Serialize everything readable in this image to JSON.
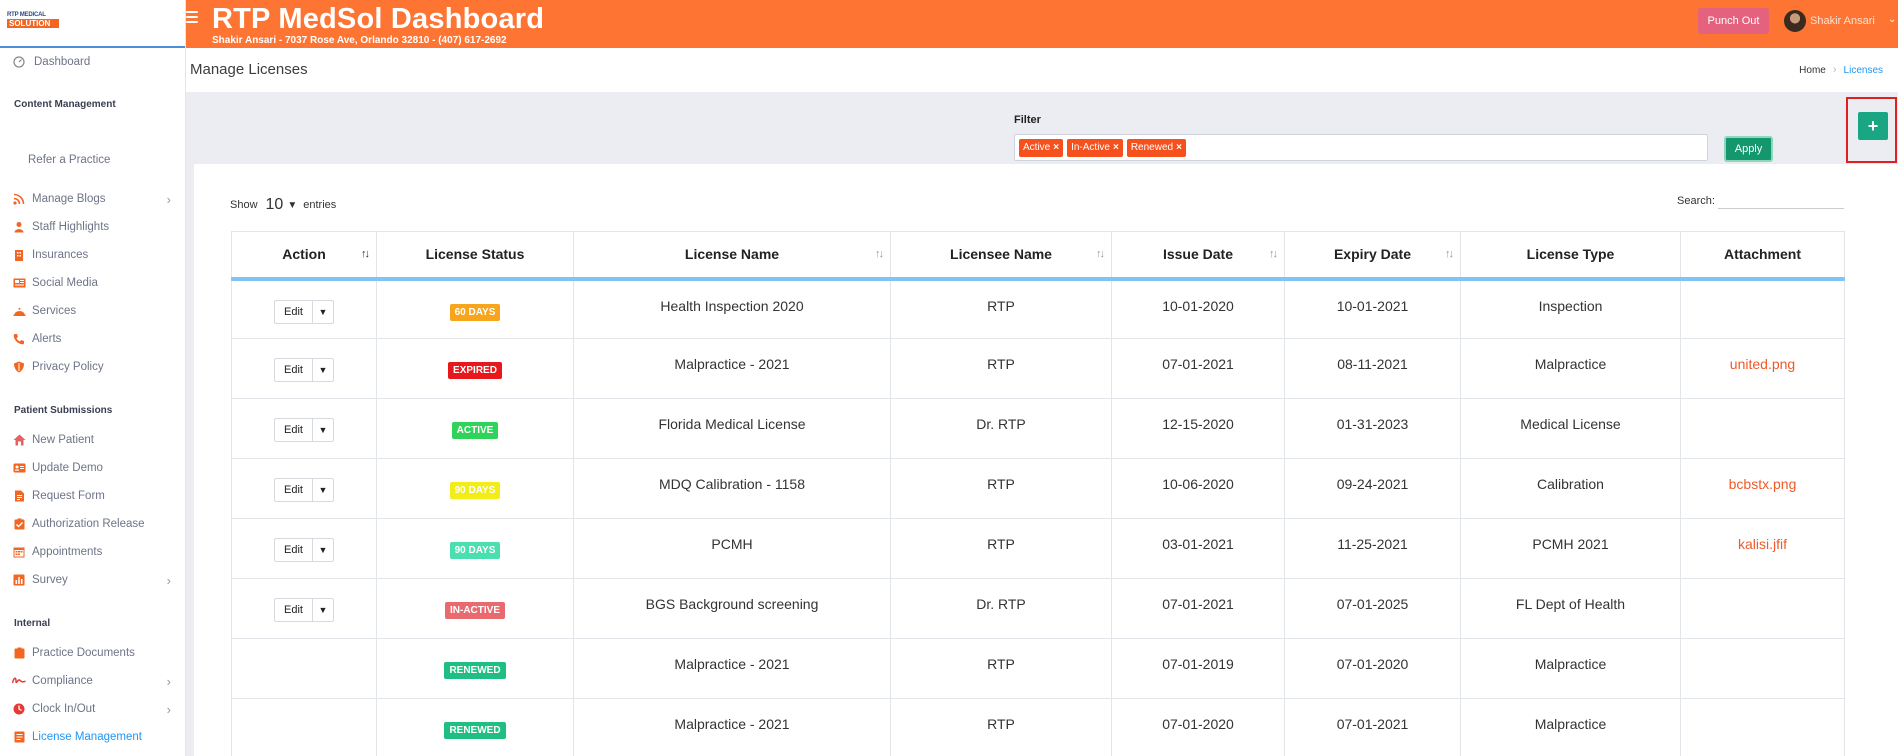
{
  "sidebar": {
    "logo_line1": "RTP MEDICAL",
    "logo_line2": "SOLUTION",
    "dashboard": "Dashboard",
    "sections": {
      "content": "Content Management",
      "patient": "Patient Submissions",
      "internal": "Internal"
    },
    "refer": "Refer a Practice",
    "items": {
      "blogs": "Manage Blogs",
      "staff": "Staff Highlights",
      "insurances": "Insurances",
      "social": "Social Media",
      "services": "Services",
      "alerts": "Alerts",
      "privacy": "Privacy Policy",
      "new_patient": "New Patient",
      "update_demo": "Update Demo",
      "request_form": "Request Form",
      "auth_release": "Authorization Release",
      "appointments": "Appointments",
      "survey": "Survey",
      "practice_docs": "Practice Documents",
      "compliance": "Compliance",
      "clock": "Clock In/Out",
      "license_mgmt": "License Management"
    },
    "accent": "#f26522",
    "active_color": "#2196f3"
  },
  "topbar": {
    "title": "RTP MedSol Dashboard",
    "subtitle": "Shakir Ansari - 7037 Rose Ave, Orlando 32810 - (407) 617-2692",
    "punch_out": "Punch Out",
    "user_name": "Shakir Ansari",
    "color": "#fd7433"
  },
  "header": {
    "page_title": "Manage Licenses",
    "breadcrumb_home": "Home",
    "breadcrumb_current": "Licenses"
  },
  "filter": {
    "label": "Filter",
    "tags": [
      "Active",
      "In-Active",
      "Renewed"
    ],
    "apply": "Apply",
    "add": "+"
  },
  "table_controls": {
    "show": "Show",
    "entries_value": "10",
    "entries": "entries",
    "search": "Search:"
  },
  "table": {
    "columns": [
      "Action",
      "License Status",
      "License Name",
      "Licensee Name",
      "Issue Date",
      "Expiry Date",
      "License Type",
      "Attachment"
    ],
    "edit_label": "Edit",
    "rows": [
      {
        "has_action": true,
        "status": "60 DAYS",
        "status_kind": "b-60",
        "name": "Health Inspection 2020",
        "licensee": "RTP",
        "issue": "10-01-2020",
        "expiry": "10-01-2021",
        "type": "Inspection",
        "attachment": ""
      },
      {
        "has_action": true,
        "status": "EXPIRED",
        "status_kind": "b-exp",
        "name": "Malpractice - 2021",
        "licensee": "RTP",
        "issue": "07-01-2021",
        "expiry": "08-11-2021",
        "type": "Malpractice",
        "attachment": "united.png"
      },
      {
        "has_action": true,
        "status": "ACTIVE",
        "status_kind": "b-act",
        "name": "Florida Medical License",
        "licensee": "Dr. RTP",
        "issue": "12-15-2020",
        "expiry": "01-31-2023",
        "type": "Medical License",
        "attachment": ""
      },
      {
        "has_action": true,
        "status": "90 DAYS",
        "status_kind": "b-90y",
        "name": "MDQ Calibration - 1158",
        "licensee": "RTP",
        "issue": "10-06-2020",
        "expiry": "09-24-2021",
        "type": "Calibration",
        "attachment": "bcbstx.png"
      },
      {
        "has_action": true,
        "status": "90 DAYS",
        "status_kind": "b-90t",
        "name": "PCMH",
        "licensee": "RTP",
        "issue": "03-01-2021",
        "expiry": "11-25-2021",
        "type": "PCMH 2021",
        "attachment": "kalisi.jfif"
      },
      {
        "has_action": true,
        "status": "IN-ACTIVE",
        "status_kind": "b-in",
        "name": "BGS Background screening",
        "licensee": "Dr. RTP",
        "issue": "07-01-2021",
        "expiry": "07-01-2025",
        "type": "FL Dept of Health",
        "attachment": ""
      },
      {
        "has_action": false,
        "status": "RENEWED",
        "status_kind": "b-ren",
        "name": "Malpractice - 2021",
        "licensee": "RTP",
        "issue": "07-01-2019",
        "expiry": "07-01-2020",
        "type": "Malpractice",
        "attachment": ""
      },
      {
        "has_action": false,
        "status": "RENEWED",
        "status_kind": "b-ren",
        "name": "Malpractice - 2021",
        "licensee": "RTP",
        "issue": "07-01-2020",
        "expiry": "07-01-2021",
        "type": "Malpractice",
        "attachment": ""
      }
    ]
  }
}
